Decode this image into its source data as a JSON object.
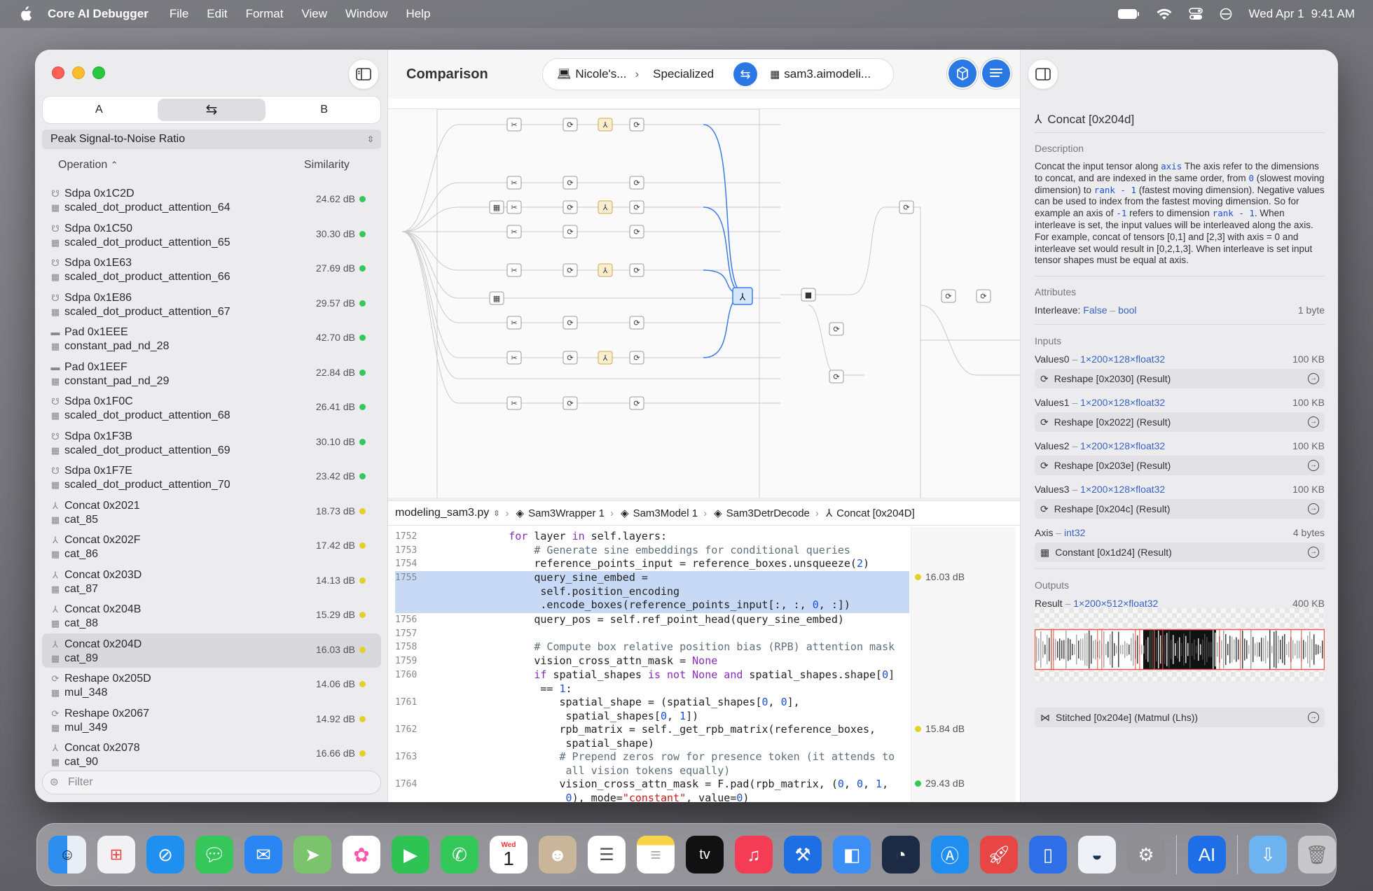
{
  "menubar": {
    "app_name": "Core AI Debugger",
    "menus": [
      "File",
      "Edit",
      "Format",
      "View",
      "Window",
      "Help"
    ],
    "date": "Wed Apr 1",
    "time": "9:41 AM"
  },
  "sidebar": {
    "segments": [
      "A",
      "B"
    ],
    "metric": "Peak Signal-to-Noise Ratio",
    "col_operation": "Operation",
    "col_similarity": "Similarity",
    "filter_placeholder": "Filter",
    "ops": [
      {
        "title": "Sdpa 0x1C2D",
        "sub": "scaled_dot_product_attention_64",
        "sim": "24.62 dB",
        "icon": "sdpa-icon",
        "status": "#34c759"
      },
      {
        "title": "Sdpa 0x1C50",
        "sub": "scaled_dot_product_attention_65",
        "sim": "30.30 dB",
        "icon": "sdpa-icon",
        "status": "#34c759"
      },
      {
        "title": "Sdpa 0x1E63",
        "sub": "scaled_dot_product_attention_66",
        "sim": "27.69 dB",
        "icon": "sdpa-icon",
        "status": "#34c759"
      },
      {
        "title": "Sdpa 0x1E86",
        "sub": "scaled_dot_product_attention_67",
        "sim": "29.57 dB",
        "icon": "sdpa-icon",
        "status": "#34c759"
      },
      {
        "title": "Pad 0x1EEE",
        "sub": "constant_pad_nd_28",
        "sim": "42.70 dB",
        "icon": "pad-icon",
        "status": "#34c759"
      },
      {
        "title": "Pad 0x1EEF",
        "sub": "constant_pad_nd_29",
        "sim": "22.84 dB",
        "icon": "pad-icon",
        "status": "#34c759"
      },
      {
        "title": "Sdpa 0x1F0C",
        "sub": "scaled_dot_product_attention_68",
        "sim": "26.41 dB",
        "icon": "sdpa-icon",
        "status": "#34c759"
      },
      {
        "title": "Sdpa 0x1F3B",
        "sub": "scaled_dot_product_attention_69",
        "sim": "30.10 dB",
        "icon": "sdpa-icon",
        "status": "#34c759"
      },
      {
        "title": "Sdpa 0x1F7E",
        "sub": "scaled_dot_product_attention_70",
        "sim": "23.42 dB",
        "icon": "sdpa-icon",
        "status": "#34c759"
      },
      {
        "title": "Concat 0x2021",
        "sub": "cat_85",
        "sim": "18.73 dB",
        "icon": "concat-icon",
        "status": "#e2d12a"
      },
      {
        "title": "Concat 0x202F",
        "sub": "cat_86",
        "sim": "17.42 dB",
        "icon": "concat-icon",
        "status": "#e2d12a"
      },
      {
        "title": "Concat 0x203D",
        "sub": "cat_87",
        "sim": "14.13 dB",
        "icon": "concat-icon",
        "status": "#e2d12a"
      },
      {
        "title": "Concat 0x204B",
        "sub": "cat_88",
        "sim": "15.29 dB",
        "icon": "concat-icon",
        "status": "#e2d12a"
      },
      {
        "title": "Concat 0x204D",
        "sub": "cat_89",
        "sim": "16.03 dB",
        "icon": "concat-icon",
        "status": "#e2d12a",
        "selected": true
      },
      {
        "title": "Reshape 0x205D",
        "sub": "mul_348",
        "sim": "14.06 dB",
        "icon": "reshape-icon",
        "status": "#e2d12a"
      },
      {
        "title": "Reshape 0x2067",
        "sub": "mul_349",
        "sim": "14.92 dB",
        "icon": "reshape-icon",
        "status": "#e2d12a"
      },
      {
        "title": "Concat 0x2078",
        "sub": "cat_90",
        "sim": "16.66 dB",
        "icon": "concat-icon",
        "status": "#e2d12a"
      }
    ]
  },
  "center": {
    "title": "Comparison",
    "crumb_device": "Nicole's...",
    "crumb_mode": "Specialized",
    "crumb_model": "sam3.aimodeli...",
    "path": [
      "modeling_sam3.py",
      "Sam3Wrapper 1",
      "Sam3Model 1",
      "Sam3DetrDecode",
      "Concat [0x204D]"
    ],
    "code": [
      {
        "n": "1752",
        "t": "        <span class='kw'>for</span> layer <span class='kw'>in</span> self.layers:"
      },
      {
        "n": "1753",
        "t": "            <span class='cm'># Generate sine embeddings for conditional queries</span>"
      },
      {
        "n": "1754",
        "t": "            reference_points_input = reference_boxes.unsqueeze(<span class='nm'>2</span>)"
      },
      {
        "n": "1755",
        "t": "            query_sine_embed =\n             self.position_encoding\n             .encode_boxes(reference_points_input[:, :, <span class='nm'>0</span>, :])",
        "sim": "16.03 dB",
        "dot": "#e2d12a"
      },
      {
        "n": "1756",
        "t": "            query_pos = self.ref_point_head(query_sine_embed)"
      },
      {
        "n": "1757",
        "t": ""
      },
      {
        "n": "1758",
        "t": "            <span class='cm'># Compute box relative position bias (RPB) attention mask</span>"
      },
      {
        "n": "1759",
        "t": "            vision_cross_attn_mask = <span class='kw'>None</span>"
      },
      {
        "n": "1760",
        "t": "            <span class='kw'>if</span> spatial_shapes <span class='kw'>is not None and</span> spatial_shapes.shape[<span class='nm'>0</span>]\n             == <span class='nm'>1</span>:"
      },
      {
        "n": "1761",
        "t": "                spatial_shape = (spatial_shapes[<span class='nm'>0</span>, <span class='nm'>0</span>],\n                 spatial_shapes[<span class='nm'>0</span>, <span class='nm'>1</span>])"
      },
      {
        "n": "1762",
        "t": "                rpb_matrix = self._get_rpb_matrix(reference_boxes,\n                 spatial_shape)",
        "sim": "15.84 dB",
        "dot": "#e2d12a"
      },
      {
        "n": "1763",
        "t": "                <span class='cm'># Prepend zeros row for presence token (it attends to\n                 all vision tokens equally)</span>"
      },
      {
        "n": "1764",
        "t": "                vision_cross_attn_mask = F.pad(rpb_matrix, (<span class='nm'>0</span>, <span class='nm'>0</span>, <span class='nm'>1</span>,\n                 <span class='nm'>0</span>), mode=<span class='st'>\"constant\"</span>, value=<span class='nm'>0</span>)",
        "sim": "29.43 dB",
        "dot": "#34c759"
      }
    ]
  },
  "inspector": {
    "title": "Concat [0x204d]",
    "desc_header": "Description",
    "description_html": "Concat the input tensor along <span class='mono'>axis</span> The axis refer to the dimensions to concat, and are indexed in the same order, from <span class='mono'>0</span> (slowest moving dimension) to <span class='mono'>rank - 1</span> (fastest moving dimension). Negative values can be used to index from the fastest moving dimension. So for example an axis of <span class='mono'>-1</span> refers to dimension <span class='mono'>rank - 1</span>. When interleave is set, the input values will be interleaved along the axis. For example, concat of tensors [0,1] and [2,3] with axis = 0 and interleave set would result in [0,2,1,3]. When interleave is set input tensor shapes must be equal at axis.",
    "attr_header": "Attributes",
    "attr_name": "Interleave:",
    "attr_value": "False",
    "attr_type": "bool",
    "attr_size": "1 byte",
    "inputs_header": "Inputs",
    "inputs": [
      {
        "name": "Values0",
        "type": "1×200×128×float32",
        "size": "100 KB",
        "link": "Reshape [0x2030] (Result)"
      },
      {
        "name": "Values1",
        "type": "1×200×128×float32",
        "size": "100 KB",
        "link": "Reshape [0x2022] (Result)"
      },
      {
        "name": "Values2",
        "type": "1×200×128×float32",
        "size": "100 KB",
        "link": "Reshape [0x203e] (Result)"
      },
      {
        "name": "Values3",
        "type": "1×200×128×float32",
        "size": "100 KB",
        "link": "Reshape [0x204c] (Result)"
      },
      {
        "name": "Axis",
        "type": "int32",
        "size": "4 bytes",
        "link": "Constant [0x1d24] (Result)"
      }
    ],
    "outputs_header": "Outputs",
    "output": {
      "name": "Result",
      "type": "1×200×512×float32",
      "size": "400 KB"
    },
    "output_link": "Stitched [0x204e] (Matmul (Lhs))"
  },
  "dock": {
    "calendar_month": "Wed",
    "calendar_day": "1",
    "tv_label": "tv",
    "ai_label": "AI"
  },
  "colors": {
    "accent": "#2b78e4",
    "good": "#34c759",
    "warn": "#e2d12a"
  }
}
